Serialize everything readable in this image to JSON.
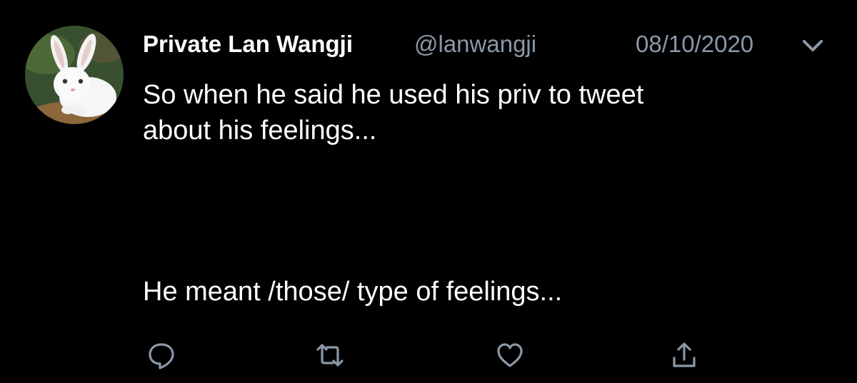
{
  "tweet": {
    "display_name": "Private Lan Wangji",
    "handle": "@lanwangji",
    "timestamp": "08/10/2020",
    "text_part1": "So when he said he used his priv to tweet\nabout his feelings...",
    "text_part2": "He meant /those/ type of feelings..."
  },
  "icons": {
    "avatar": "white-rabbit-avatar",
    "caret": "chevron-down-icon",
    "reply": "reply-icon",
    "retweet": "retweet-icon",
    "like": "heart-icon",
    "share": "share-icon"
  },
  "colors": {
    "background": "#000000",
    "text": "#ffffff",
    "muted": "#8b98a5"
  }
}
